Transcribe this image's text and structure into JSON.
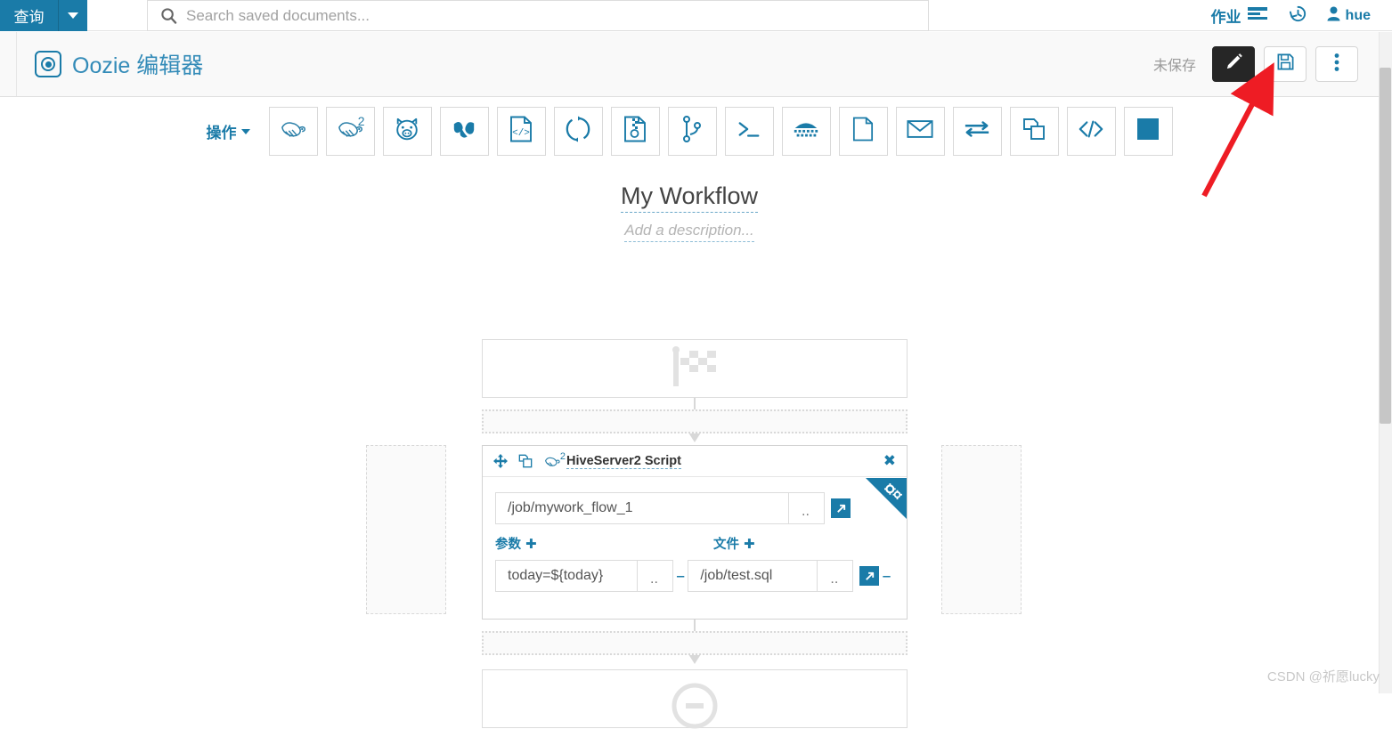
{
  "navbar": {
    "left_button_label": "查询",
    "left_caret_icon": "chevron-down-icon",
    "search": {
      "icon": "search-icon",
      "placeholder": "Search saved documents...",
      "value": ""
    },
    "jobs_label": "作业",
    "jobs_icon": "list-icon",
    "history_icon": "history-icon",
    "user_icon": "user-icon",
    "user_label": "hue"
  },
  "app_header": {
    "logo_icon": "oozie-target-icon",
    "title": "Oozie 编辑器",
    "status_label": "未保存",
    "edit_button": {
      "icon": "pencil-icon",
      "label": ""
    },
    "save_button": {
      "icon": "floppy-save-icon",
      "label": ""
    },
    "more_button": {
      "icon": "kebab-menu-icon",
      "label": ""
    }
  },
  "toolbar": {
    "label": "操作",
    "caret_icon": "caret-down-icon",
    "actions": [
      {
        "name": "hive-action",
        "icon": "hive-bee-icon",
        "badge": ""
      },
      {
        "name": "hiveserver2-action",
        "icon": "hive-bee-icon",
        "badge": "2"
      },
      {
        "name": "pig-action",
        "icon": "pig-icon",
        "badge": ""
      },
      {
        "name": "sqoop-action",
        "icon": "sqoop-bird-icon",
        "badge": ""
      },
      {
        "name": "java-action",
        "icon": "code-document-icon",
        "badge": ""
      },
      {
        "name": "mapreduce-action",
        "icon": "circle-arrows-icon",
        "badge": ""
      },
      {
        "name": "spark-action",
        "icon": "zip-document-icon",
        "badge": ""
      },
      {
        "name": "distcp-action",
        "icon": "git-branch-icon",
        "badge": ""
      },
      {
        "name": "shell-action",
        "icon": "terminal-icon",
        "badge": ""
      },
      {
        "name": "ssh-action",
        "icon": "keyboard-icon",
        "badge": ""
      },
      {
        "name": "fs-action",
        "icon": "blank-document-icon",
        "badge": ""
      },
      {
        "name": "email-action",
        "icon": "envelope-icon",
        "badge": ""
      },
      {
        "name": "streaming-action",
        "icon": "exchange-arrows-icon",
        "badge": ""
      },
      {
        "name": "subworkflow-action",
        "icon": "copy-pages-icon",
        "badge": ""
      },
      {
        "name": "generic-action",
        "icon": "angle-brackets-icon",
        "badge": ""
      },
      {
        "name": "kill-action",
        "icon": "filled-square-icon",
        "badge": ""
      }
    ]
  },
  "workflow": {
    "title": "My Workflow",
    "description_placeholder": "Add a description..."
  },
  "graph": {
    "start_node": {
      "icon": "checkered-flag-icon",
      "label": ""
    },
    "action_node": {
      "move_icon": "move-cross-icon",
      "copy_icon": "copy-pages-icon",
      "type_icon": "hive-bee-icon",
      "type_badge": "2",
      "title": "HiveServer2 Script",
      "close_icon": "close-x-icon",
      "gear_icon": "gears-icon",
      "script": {
        "value": "/job/mywork_flow_1",
        "browse_label": "..",
        "external_icon": "external-link-icon"
      },
      "params": {
        "label": "参数",
        "add_icon": "plus-icon",
        "value": "today=${today}",
        "browse_label": ".."
      },
      "files": {
        "label": "文件",
        "add_icon": "plus-icon",
        "value": "/job/test.sql",
        "browse_label": "..",
        "external_icon": "external-link-icon",
        "remove_icon": "minus-icon"
      }
    },
    "end_node": {
      "icon": "stop-circle-icon",
      "label": ""
    }
  },
  "annotation": {
    "arrow_color": "#ee1c24",
    "type": "arrow-pointer"
  },
  "watermark": "CSDN @祈愿lucky",
  "colors": {
    "brand_blue": "#1a7ba8",
    "header_bg": "#f9f9f9",
    "dark_button": "#262626"
  }
}
